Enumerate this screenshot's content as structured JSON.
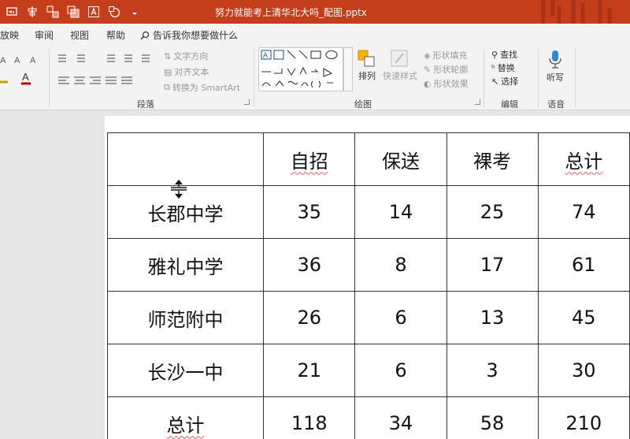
{
  "window": {
    "title": "努力就能考上清华北大吗_配图.pptx",
    "accent": "#c43e1c"
  },
  "tabs": {
    "items": [
      "放映",
      "审阅",
      "视图",
      "帮助"
    ],
    "tell_me": "告诉我你想要做什么"
  },
  "ribbon": {
    "paragraph": {
      "label": "段落",
      "text_direction": "文字方向",
      "align_text": "对齐文本",
      "smartart": "转换为 SmartArt"
    },
    "drawing": {
      "label": "绘图",
      "arrange": "排列",
      "quick_styles": "快速样式",
      "shape_fill": "形状填充",
      "shape_outline": "形状轮廓",
      "shape_effects": "形状效果"
    },
    "editing": {
      "label": "编辑",
      "find": "查找",
      "replace": "替换",
      "select": "选择"
    },
    "voice": {
      "label": "语音",
      "dictate": "听写"
    }
  },
  "table": {
    "headers": [
      "",
      "自招",
      "保送",
      "裸考",
      "总计"
    ],
    "rows": [
      [
        "长郡中学",
        "35",
        "14",
        "25",
        "74"
      ],
      [
        "雅礼中学",
        "36",
        "8",
        "17",
        "61"
      ],
      [
        "师范附中",
        "26",
        "6",
        "13",
        "45"
      ],
      [
        "长沙一中",
        "21",
        "6",
        "3",
        "30"
      ],
      [
        "总计",
        "118",
        "34",
        "58",
        "210"
      ]
    ]
  }
}
